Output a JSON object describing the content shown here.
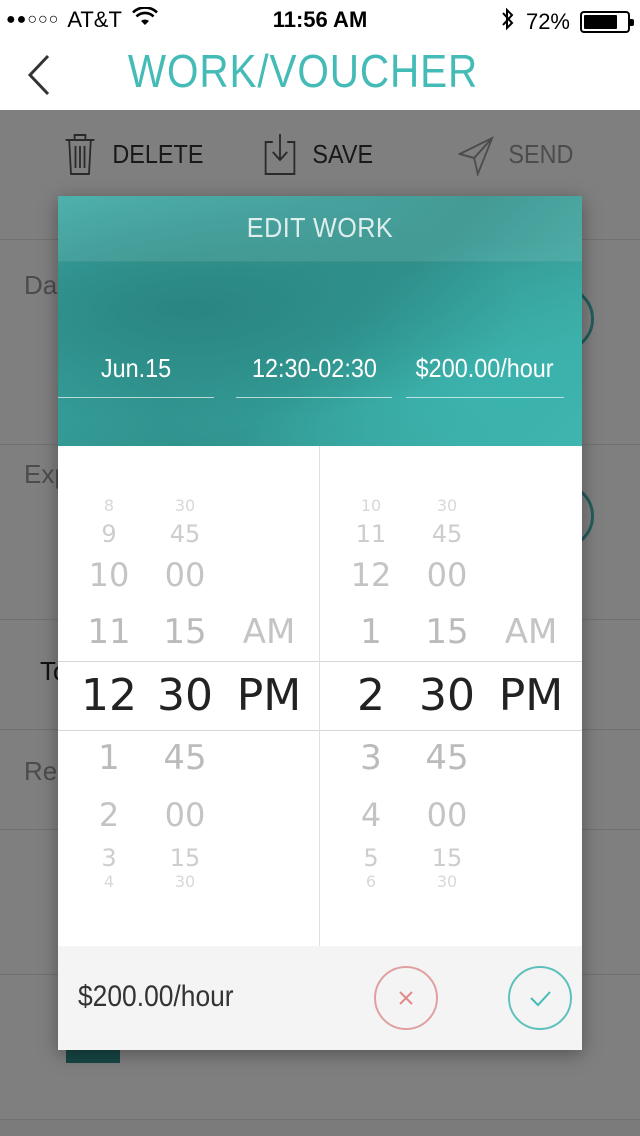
{
  "status_bar": {
    "signal": "●●○○○",
    "carrier": "AT&T",
    "time": "11:56 AM",
    "battery": "72%"
  },
  "nav": {
    "title": "WORK/VOUCHER"
  },
  "toolbar": {
    "delete_label": "DELETE",
    "save_label": "SAVE",
    "send_label": "SEND"
  },
  "background_rows": [
    {
      "label": "Da"
    },
    {
      "label": "Exp"
    },
    {
      "label": "To"
    },
    {
      "label": "Rei"
    }
  ],
  "modal": {
    "title": "EDIT WORK",
    "date": "Jun.15",
    "time_range": "12:30-02:30",
    "rate": "$200.00/hour",
    "footer_rate": "$200.00/hour",
    "start_picker": {
      "hours": [
        "8",
        "9",
        "10",
        "11",
        "12",
        "1",
        "2",
        "3",
        "4"
      ],
      "minutes": [
        "30",
        "45",
        "00",
        "15",
        "30",
        "45",
        "00",
        "15",
        "30"
      ],
      "ampm": [
        "AM",
        "PM"
      ],
      "selected": {
        "hour": "12",
        "minute": "30",
        "ampm": "PM"
      }
    },
    "end_picker": {
      "hours": [
        "10",
        "11",
        "12",
        "1",
        "2",
        "3",
        "4",
        "5",
        "6"
      ],
      "minutes": [
        "30",
        "45",
        "00",
        "15",
        "30",
        "45",
        "00",
        "15",
        "30"
      ],
      "ampm": [
        "AM",
        "PM"
      ],
      "selected": {
        "hour": "2",
        "minute": "30",
        "ampm": "PM"
      }
    }
  },
  "colors": {
    "accent": "#45bbb7",
    "header": "#2f8f8a",
    "cancel": "#e0a0a0",
    "confirm": "#5cc1bb"
  }
}
